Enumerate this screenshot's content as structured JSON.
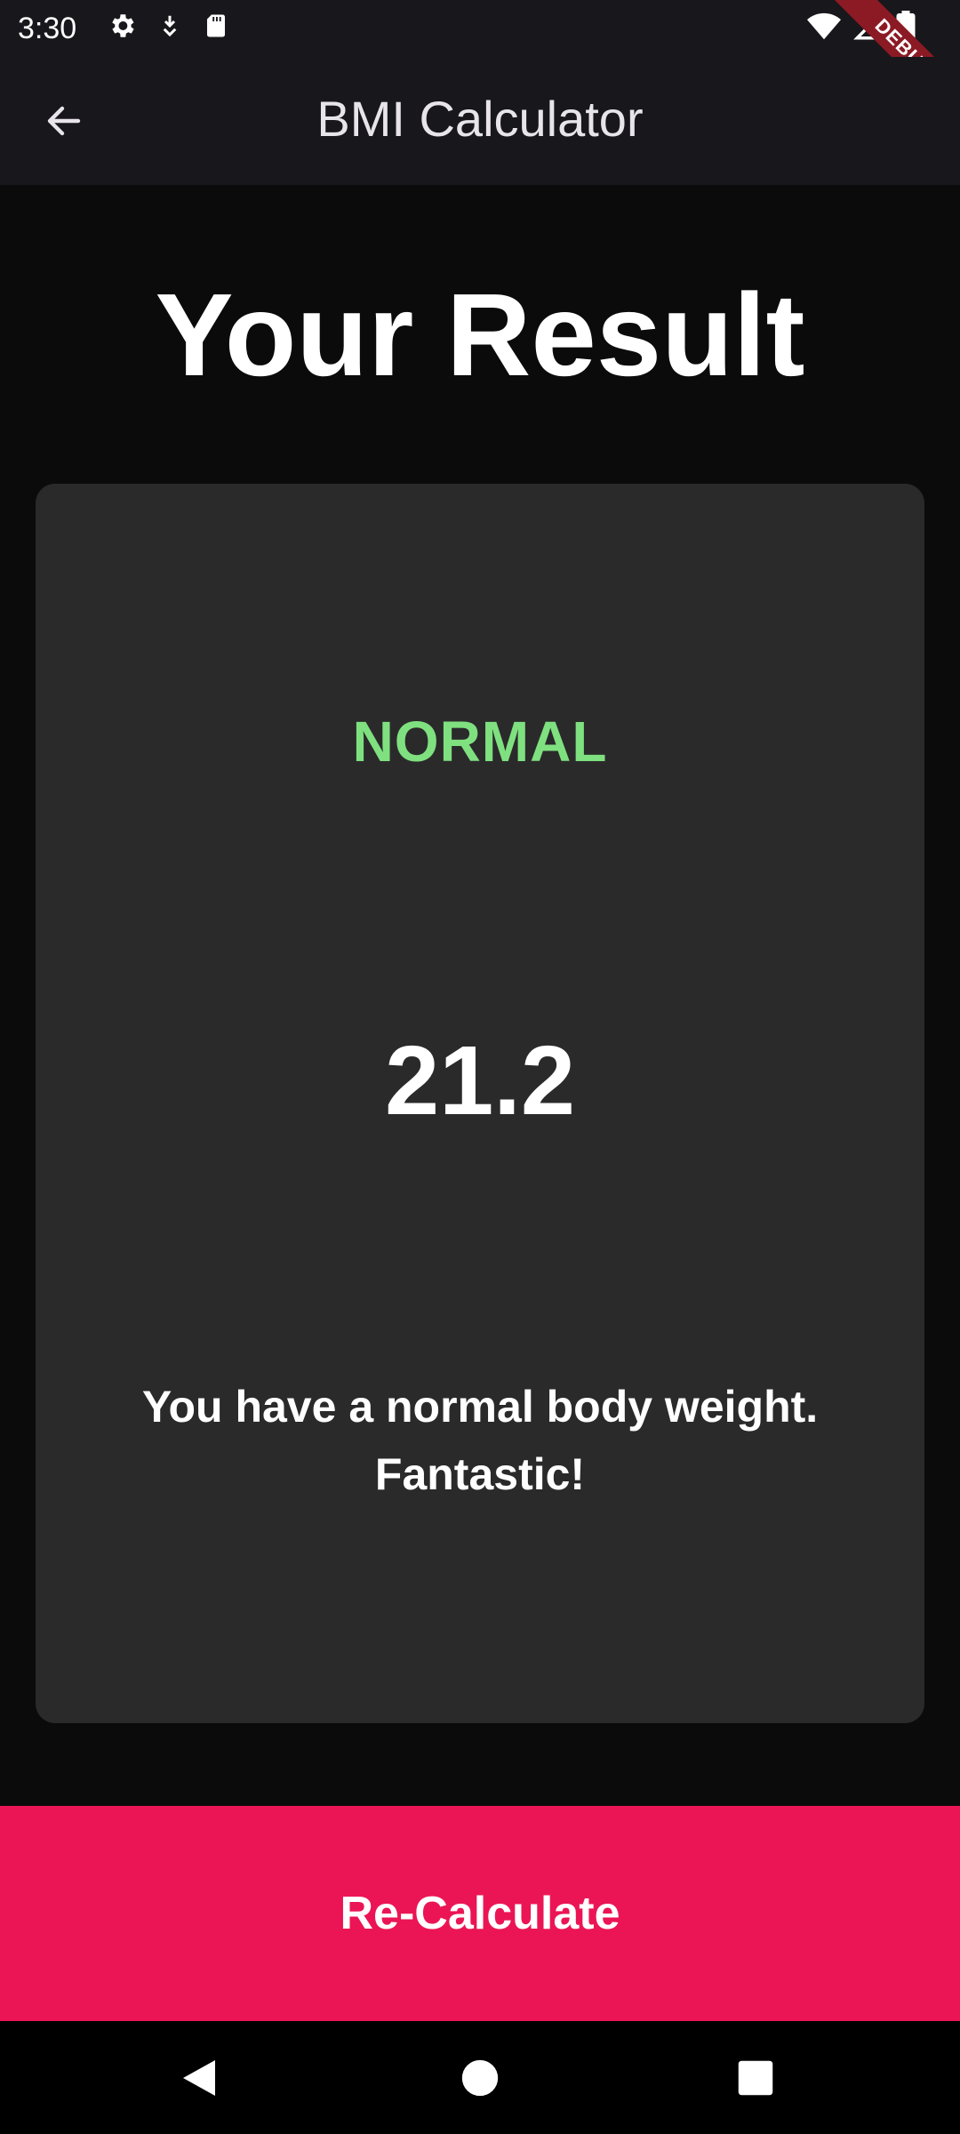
{
  "status_bar": {
    "time": "3:30",
    "icons_left": [
      "settings-icon",
      "download-icon",
      "sd-card-icon"
    ],
    "icons_right": [
      "wifi-icon",
      "signal-icon",
      "battery-icon"
    ]
  },
  "debug_banner": {
    "label": "DEBUG"
  },
  "app_bar": {
    "title": "BMI Calculator",
    "back_icon": "arrow-back-icon"
  },
  "page": {
    "title": "Your Result"
  },
  "result": {
    "status": "NORMAL",
    "status_color": "#7fe07f",
    "bmi_value": "21.2",
    "message": "You have a normal body weight. Fantastic!"
  },
  "action": {
    "recalculate_label": "Re-Calculate",
    "color": "#eb1555"
  },
  "nav_bar": {
    "buttons": [
      "back-triangle-icon",
      "home-circle-icon",
      "recents-square-icon"
    ]
  }
}
